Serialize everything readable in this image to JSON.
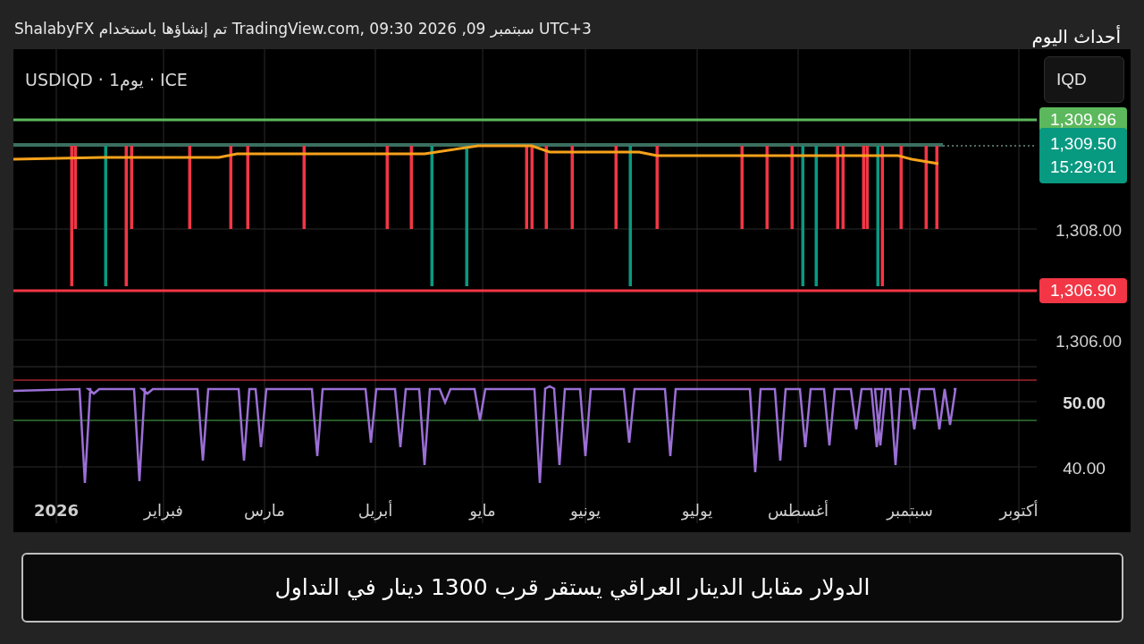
{
  "header": {
    "credit": "ShalabyFX تم إنشاؤها باستخدام TradingView.com, 09:30 2026 ,09 سبتمبر UTC+3",
    "section": "أحداث اليوم"
  },
  "chart": {
    "legend": "USDIQD · 1يوم · ICE",
    "currency_button": "IQD",
    "price_labels": [
      {
        "kind": "plain",
        "text": "1,308.00"
      },
      {
        "kind": "plain",
        "text": "1,306.00"
      }
    ],
    "level_tags": [
      {
        "kind": "resistance",
        "text": "1,309.96",
        "color": "#5cb85c"
      },
      {
        "kind": "last",
        "text": "1,309.50",
        "time": "15:29:01",
        "color": "#089981"
      },
      {
        "kind": "support",
        "text": "1,306.90",
        "color": "#f23645"
      }
    ],
    "indicator_labels": [
      {
        "text": "50.00",
        "bold": true
      },
      {
        "text": "40.00",
        "bold": false
      }
    ],
    "x_labels": [
      {
        "text": "أكتوبر",
        "bold": false
      },
      {
        "text": "سبتمبر",
        "bold": false
      },
      {
        "text": "أغسطس",
        "bold": false
      },
      {
        "text": "يوليو",
        "bold": false
      },
      {
        "text": "يونيو",
        "bold": false
      },
      {
        "text": "مايو",
        "bold": false
      },
      {
        "text": "أبريل",
        "bold": false
      },
      {
        "text": "مارس",
        "bold": false
      },
      {
        "text": "فبراير",
        "bold": false
      },
      {
        "text": "2026",
        "bold": true
      }
    ]
  },
  "caption": "الدولار مقابل الدينار العراقي يستقر قرب 1300 دينار في التداول"
}
